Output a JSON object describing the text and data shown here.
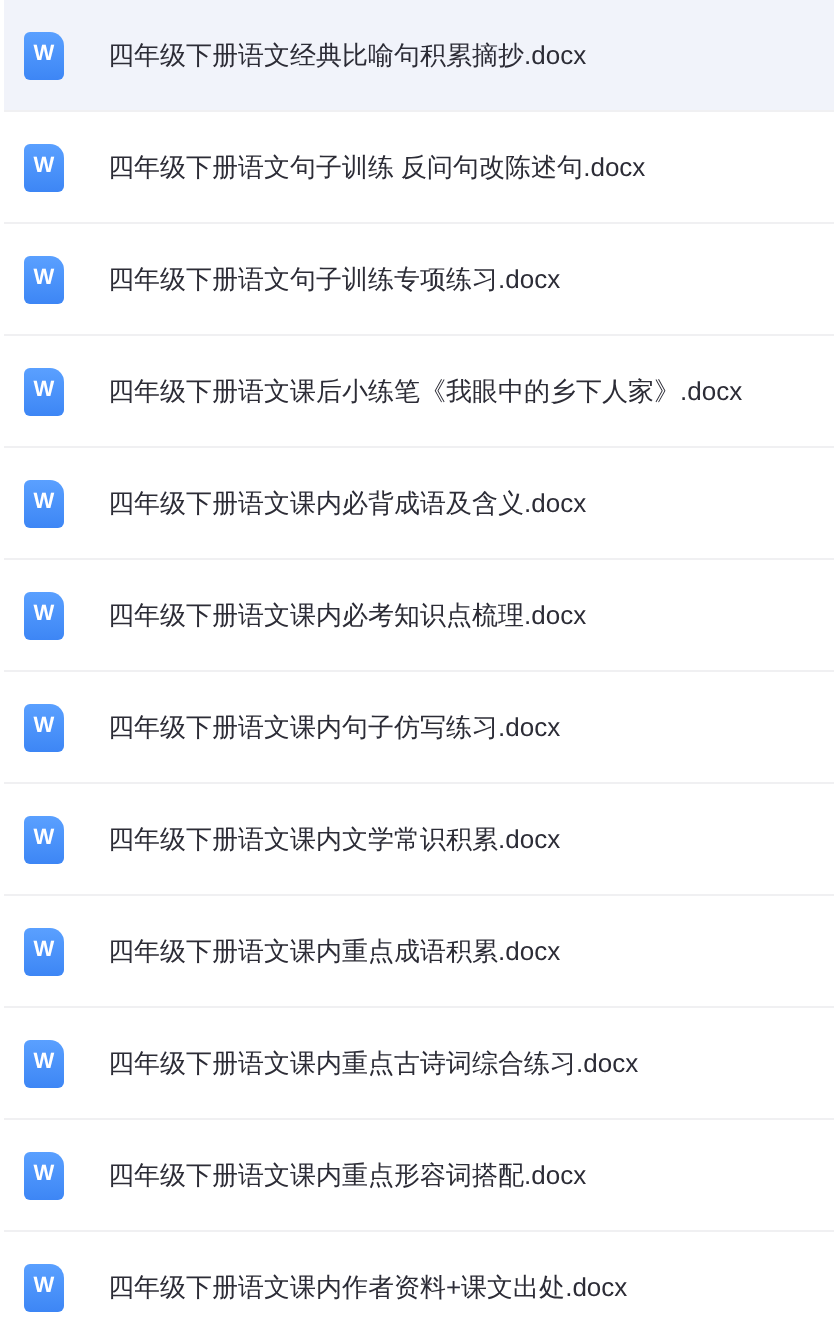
{
  "files": [
    {
      "name": "四年级下册语文经典比喻句积累摘抄.docx",
      "icon_label": "W",
      "selected": true
    },
    {
      "name": "四年级下册语文句子训练 反问句改陈述句.docx",
      "icon_label": "W",
      "selected": false
    },
    {
      "name": "四年级下册语文句子训练专项练习.docx",
      "icon_label": "W",
      "selected": false
    },
    {
      "name": "四年级下册语文课后小练笔《我眼中的乡下人家》.docx",
      "icon_label": "W",
      "selected": false
    },
    {
      "name": "四年级下册语文课内必背成语及含义.docx",
      "icon_label": "W",
      "selected": false
    },
    {
      "name": "四年级下册语文课内必考知识点梳理.docx",
      "icon_label": "W",
      "selected": false
    },
    {
      "name": "四年级下册语文课内句子仿写练习.docx",
      "icon_label": "W",
      "selected": false
    },
    {
      "name": "四年级下册语文课内文学常识积累.docx",
      "icon_label": "W",
      "selected": false
    },
    {
      "name": "四年级下册语文课内重点成语积累.docx",
      "icon_label": "W",
      "selected": false
    },
    {
      "name": "四年级下册语文课内重点古诗词综合练习.docx",
      "icon_label": "W",
      "selected": false
    },
    {
      "name": "四年级下册语文课内重点形容词搭配.docx",
      "icon_label": "W",
      "selected": false
    },
    {
      "name": "四年级下册语文课内作者资料+课文出处.docx",
      "icon_label": "W",
      "selected": false
    }
  ]
}
